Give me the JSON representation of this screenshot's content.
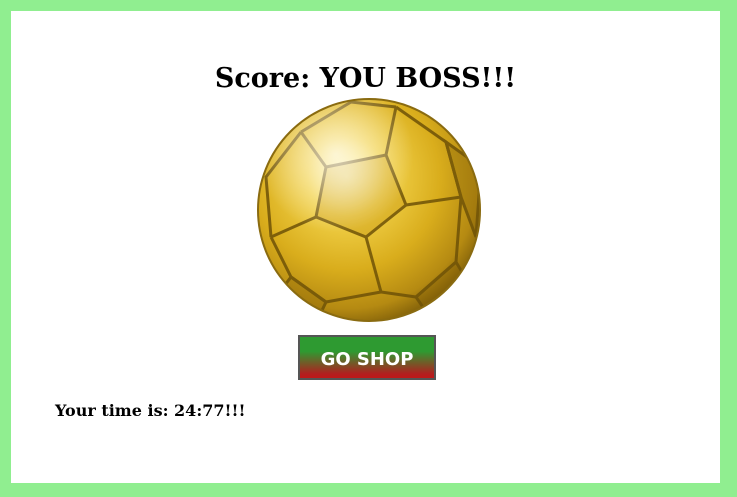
{
  "score": {
    "label": "Score: YOU BOSS!!!"
  },
  "ball": {
    "icon": "golden-soccer-ball-icon",
    "colors": {
      "gold_light": "#fff3a0",
      "gold_mid": "#e6c12a",
      "gold_dark": "#8a6b10"
    }
  },
  "shop_button": {
    "label": "GO SHOP",
    "colors": {
      "top": "#2e9a31",
      "bottom": "#c01818"
    }
  },
  "time": {
    "label": "Your time is: 24:77!!!"
  },
  "theme": {
    "page_border": "#90ee90",
    "panel": "#ffffff"
  }
}
